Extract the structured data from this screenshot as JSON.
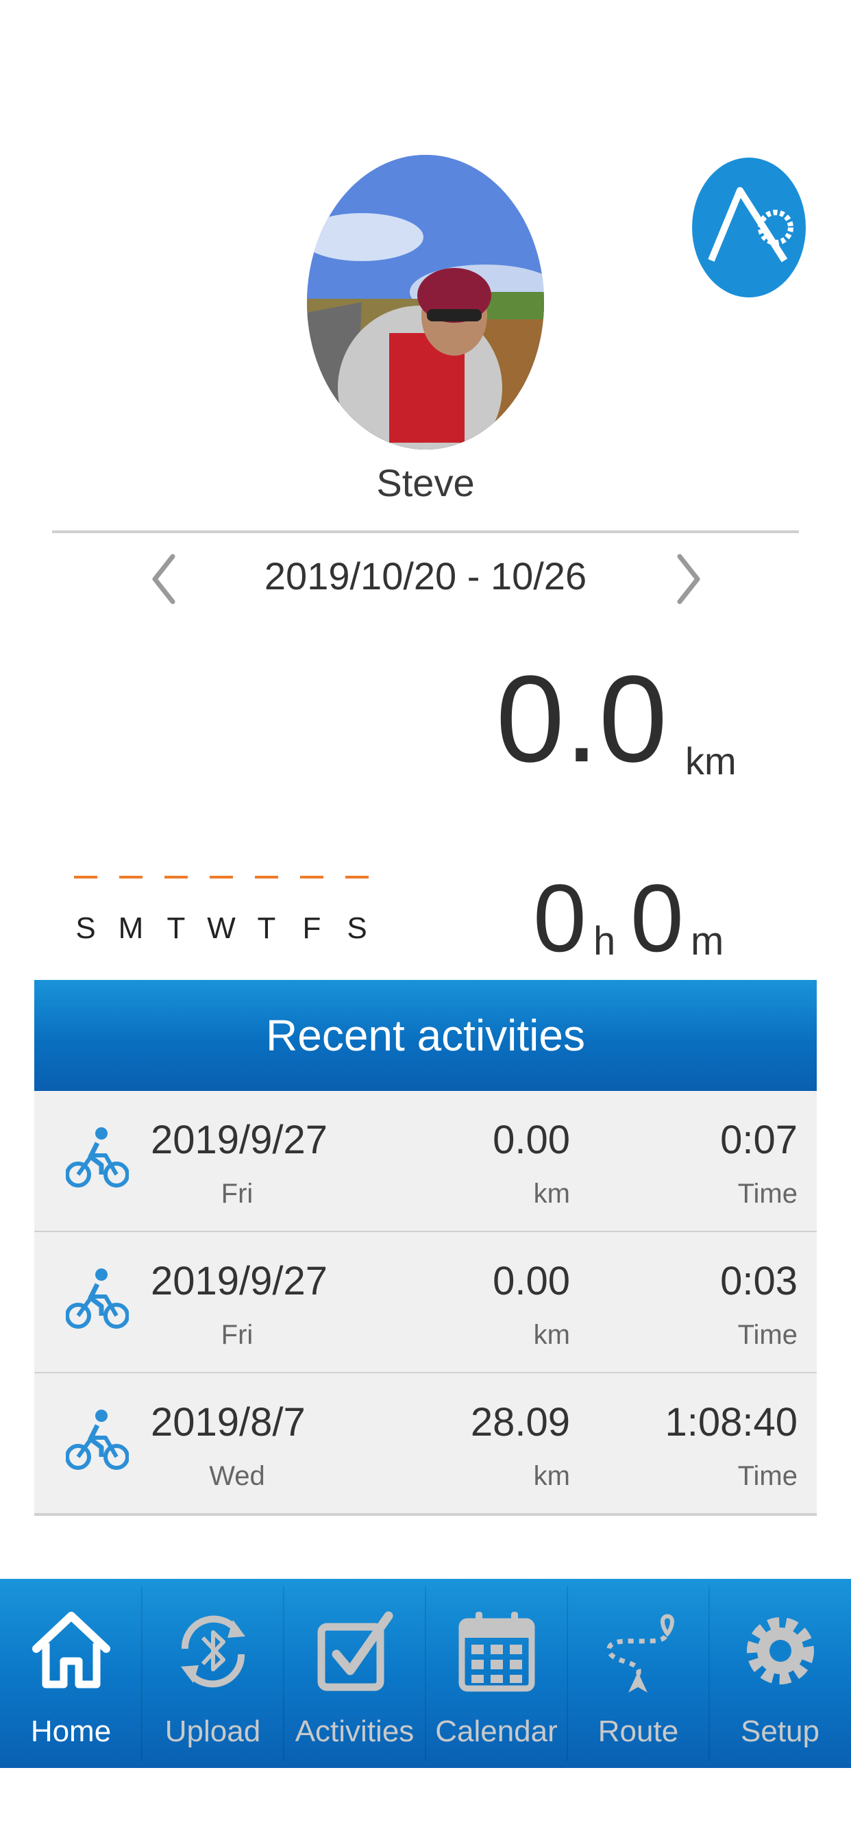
{
  "profile": {
    "name": "Steve"
  },
  "week": {
    "range": "2019/10/20 - 10/26",
    "prev_icon": "chevron-left-icon",
    "next_icon": "chevron-right-icon",
    "days": [
      "S",
      "M",
      "T",
      "W",
      "T",
      "F",
      "S"
    ]
  },
  "summary": {
    "distance_value": "0.0",
    "distance_unit": "km",
    "hours_value": "0",
    "hours_unit": "h",
    "minutes_value": "0",
    "minutes_unit": "m"
  },
  "recent": {
    "title": "Recent activities",
    "rows": [
      {
        "date": "2019/9/27",
        "dow": "Fri",
        "distance": "0.00",
        "distance_unit": "km",
        "time": "0:07",
        "time_label": "Time"
      },
      {
        "date": "2019/9/27",
        "dow": "Fri",
        "distance": "0.00",
        "distance_unit": "km",
        "time": "0:03",
        "time_label": "Time"
      },
      {
        "date": "2019/8/7",
        "dow": "Wed",
        "distance": "28.09",
        "distance_unit": "km",
        "time": "1:08:40",
        "time_label": "Time"
      }
    ]
  },
  "tabs": [
    {
      "label": "Home",
      "icon": "home-icon",
      "active": true
    },
    {
      "label": "Upload",
      "icon": "bluetooth-sync-icon"
    },
    {
      "label": "Activities",
      "icon": "checkbox-icon"
    },
    {
      "label": "Calendar",
      "icon": "calendar-icon"
    },
    {
      "label": "Route",
      "icon": "route-icon"
    },
    {
      "label": "Setup",
      "icon": "gear-icon"
    }
  ],
  "colors": {
    "accent_blue": "#1a8fd8",
    "tab_active": "#ffffff",
    "tab_inactive": "#c9c9c9",
    "day_dash": "#f07b28"
  }
}
